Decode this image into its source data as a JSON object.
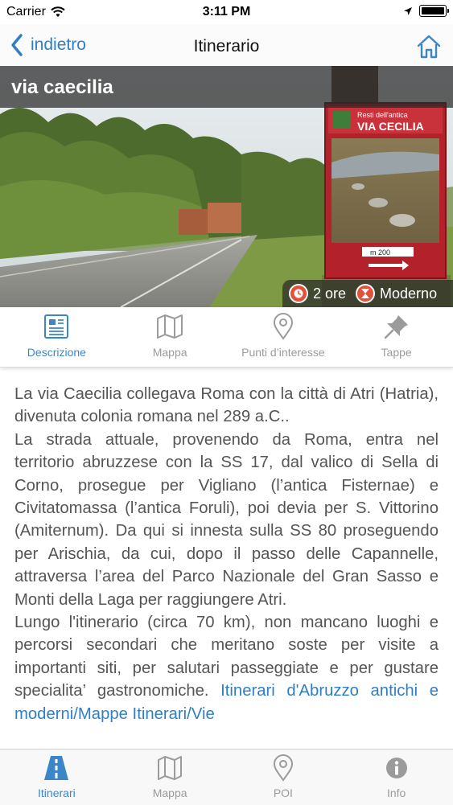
{
  "status": {
    "carrier": "Carrier",
    "time": "3:11 PM"
  },
  "nav": {
    "back_label": "indietro",
    "title": "Itinerario"
  },
  "hero": {
    "title": "via caecilia",
    "duration": "2 ore",
    "era": "Moderno",
    "sign_header": "Resti dell'antica",
    "sign_title": "VIA CECILIA",
    "sign_distance": "m 200"
  },
  "segments": [
    {
      "label": "Descrizione",
      "icon": "document-icon",
      "active": true
    },
    {
      "label": "Mappa",
      "icon": "map-icon",
      "active": false
    },
    {
      "label": "Punti d’interesse",
      "icon": "map-pin-icon",
      "active": false
    },
    {
      "label": "Tappe",
      "icon": "pushpin-icon",
      "active": false
    }
  ],
  "description": {
    "p1": "La via Caecilia collegava Roma con la città di Atri (Hatria), divenuta colonia romana nel 289 a.C..",
    "p2": "La strada attuale, provenendo da Roma, entra nel territorio abruzzese con la SS 17, dal valico di Sella di Corno, prosegue per Vigliano (l’antica Fisternae) e Civitatomassa (l’antica Foruli), poi devia per S. Vittorino (Amiternum). Da qui si innesta sulla SS 80 proseguendo per Arischia, da cui, dopo il passo delle Capannelle, attraversa l’area del Parco Nazionale del Gran Sasso e Monti della Laga per raggiungere Atri.",
    "p3": "Lungo l'itinerario (circa 70 km), non mancano luoghi e percorsi secondari che meritano soste per visite a importanti siti, per salutari passeggiate e per gustare specialita’ gastronomiche.",
    "link": "Itinerari d'Abruzzo antichi e moderni/Mappe Itinerari/Vie"
  },
  "bottom_tabs": [
    {
      "label": "Itinerari",
      "icon": "road-icon",
      "active": true
    },
    {
      "label": "Mappa",
      "icon": "map-icon",
      "active": false
    },
    {
      "label": "POI",
      "icon": "map-pin-icon",
      "active": false
    },
    {
      "label": "Info",
      "icon": "info-icon",
      "active": false
    }
  ],
  "colors": {
    "accent": "#3b86c8",
    "inactive": "#9b9b9b",
    "badge": "#e5503a"
  }
}
